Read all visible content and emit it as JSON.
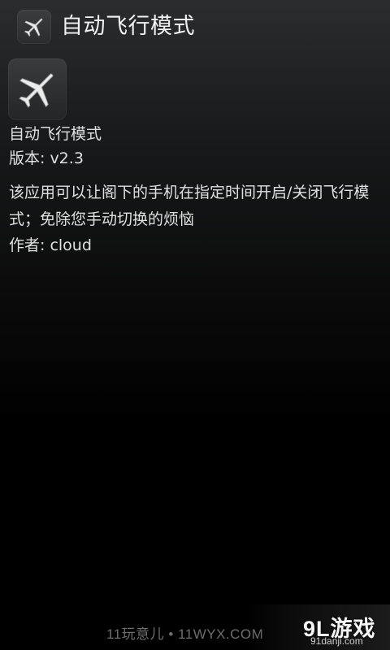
{
  "titlebar": {
    "icon": "airplane-icon",
    "title": "自动飞行模式"
  },
  "about": {
    "icon": "airplane-icon",
    "app_name": "自动飞行模式",
    "version": "版本: v2.3",
    "description": "该应用可以让阁下的手机在指定时间开启/关闭飞行模式；免除您手动切换的烦恼",
    "author": "作者: cloud"
  },
  "watermarks": {
    "left": "11玩意儿 • 11WYX.COM",
    "right_logo": "9L游戏",
    "right_sub": "91danji.com"
  }
}
